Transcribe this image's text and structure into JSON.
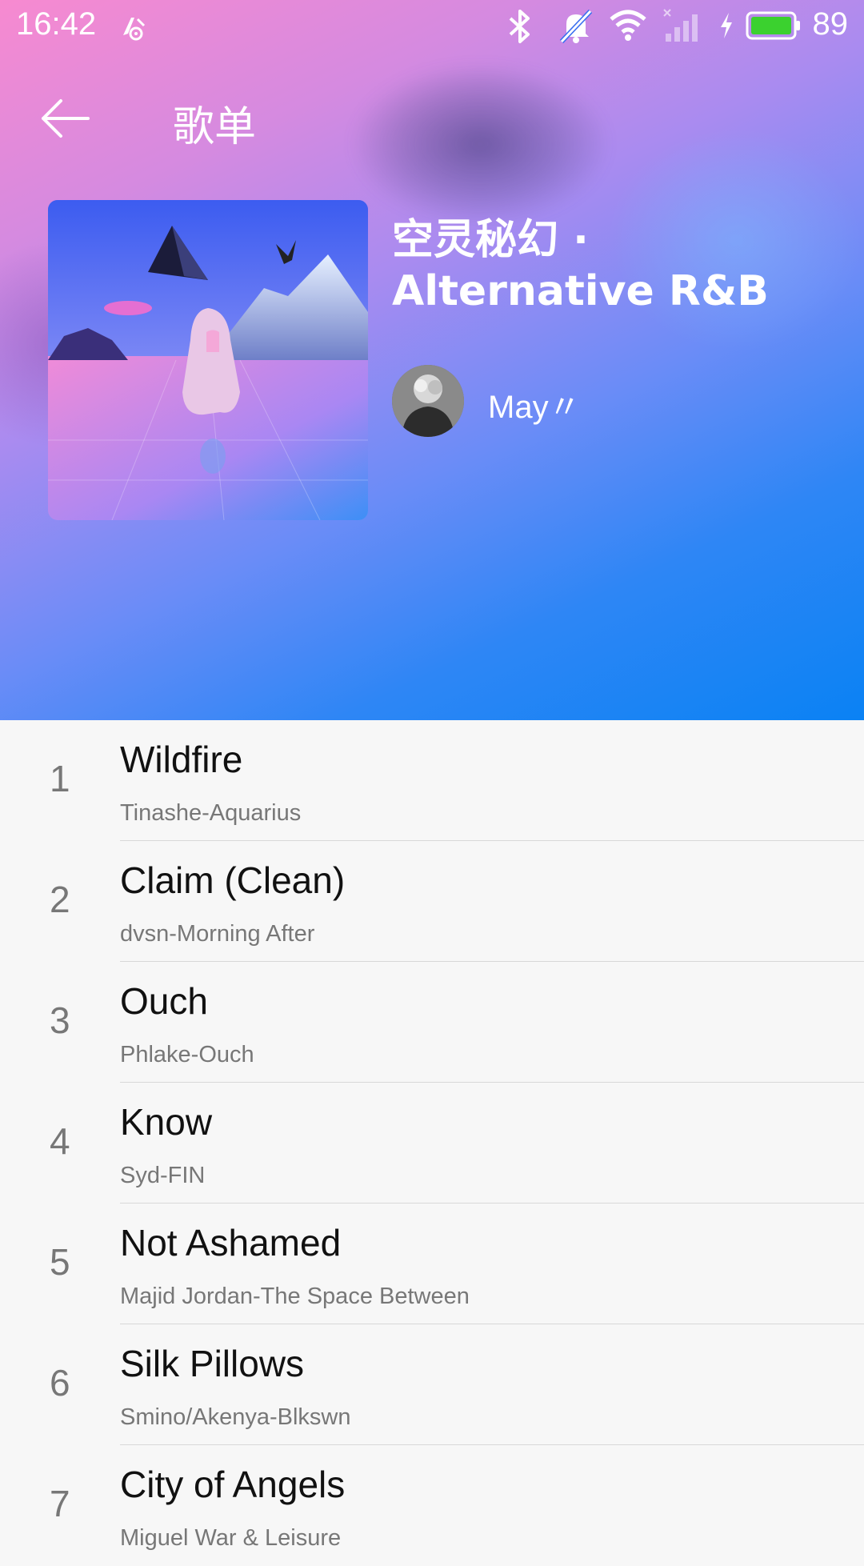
{
  "status_bar": {
    "time": "16:42",
    "battery": "89",
    "icons": [
      "notification-app-icon",
      "bluetooth-icon",
      "mute-bell-icon",
      "wifi-icon",
      "signal-icon",
      "charging-icon",
      "battery-icon"
    ],
    "battery_color": "#3bd12f"
  },
  "header": {
    "title": "歌单",
    "back_icon": "arrow-left-icon"
  },
  "playlist": {
    "title": "空灵秘幻 · Alternative R&B",
    "creator": "May〃"
  },
  "songs": [
    {
      "num": "1",
      "title": "Wildfire",
      "sub": "Tinashe-Aquarius"
    },
    {
      "num": "2",
      "title": "Claim (Clean)",
      "sub": "dvsn-Morning After"
    },
    {
      "num": "3",
      "title": "Ouch",
      "sub": "Phlake-Ouch"
    },
    {
      "num": "4",
      "title": "Know",
      "sub": "Syd-FIN"
    },
    {
      "num": "5",
      "title": "Not Ashamed",
      "sub": "Majid Jordan-The Space Between"
    },
    {
      "num": "6",
      "title": "Silk Pillows",
      "sub": "Smino/Akenya-Blkswn"
    },
    {
      "num": "7",
      "title": "City of Angels",
      "sub": "Miguel War & Leisure"
    }
  ],
  "colors": {
    "hero_start": "#f78ad0",
    "hero_end": "#0a82f4",
    "list_background": "#f7f7f7"
  }
}
